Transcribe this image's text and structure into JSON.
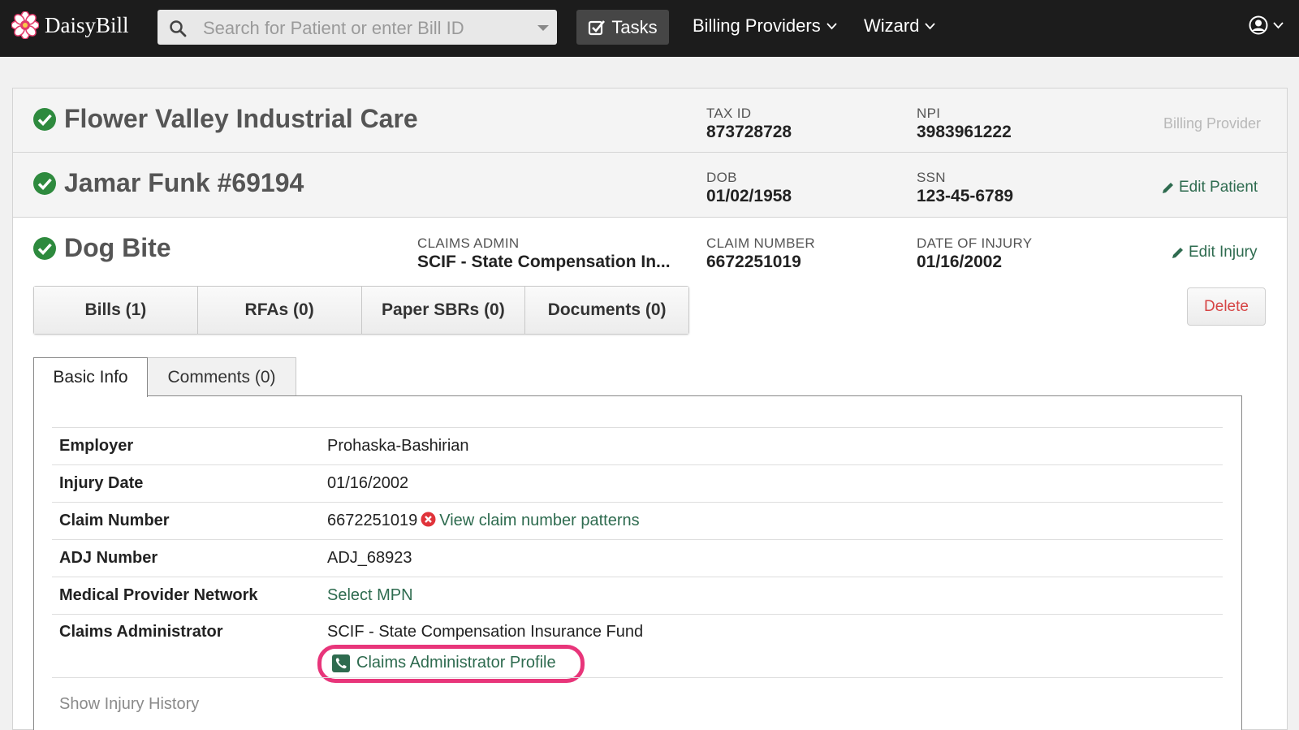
{
  "nav": {
    "brand": "DaisyBill",
    "search_placeholder": "Search for Patient or enter Bill ID",
    "tasks_label": "Tasks",
    "billing_providers_label": "Billing Providers",
    "wizard_label": "Wizard"
  },
  "provider": {
    "name": "Flower Valley Industrial Care",
    "tax_id_label": "TAX ID",
    "tax_id": "873728728",
    "npi_label": "NPI",
    "npi": "3983961222",
    "role": "Billing Provider"
  },
  "patient": {
    "name": "Jamar Funk #69194",
    "dob_label": "DOB",
    "dob": "01/02/1958",
    "ssn_label": "SSN",
    "ssn": "123-45-6789",
    "edit_label": "Edit Patient"
  },
  "injury": {
    "name": "Dog Bite",
    "claims_admin_label": "CLAIMS ADMIN",
    "claims_admin": "SCIF - State Compensation In...",
    "claim_number_label": "CLAIM NUMBER",
    "claim_number": "6672251019",
    "date_label": "DATE OF INJURY",
    "date": "01/16/2002",
    "edit_label": "Edit Injury",
    "delete_label": "Delete"
  },
  "buttons": {
    "bills": "Bills (1)",
    "rfas": "RFAs (0)",
    "paper_sbrs": "Paper SBRs (0)",
    "documents": "Documents (0)"
  },
  "tabs": {
    "basic_info": "Basic Info",
    "comments": "Comments (0)"
  },
  "details": {
    "employer_label": "Employer",
    "employer": "Prohaska-Bashirian",
    "injury_date_label": "Injury Date",
    "injury_date": "01/16/2002",
    "claim_number_label": "Claim Number",
    "claim_number": "6672251019",
    "claim_patterns_link": "View claim number patterns",
    "adj_label": "ADJ Number",
    "adj": "ADJ_68923",
    "mpn_label": "Medical Provider Network",
    "mpn_link": "Select MPN",
    "ca_label": "Claims Administrator",
    "ca_value": "SCIF - State Compensation Insurance Fund",
    "ca_profile_link": "Claims Administrator Profile",
    "show_history": "Show Injury History"
  },
  "colors": {
    "nav_bg": "#1c1c1c",
    "green_check": "#2e8a3e",
    "link_green": "#2e6b4f",
    "delete_red": "#d64545",
    "highlight_pink": "#e8357a"
  }
}
